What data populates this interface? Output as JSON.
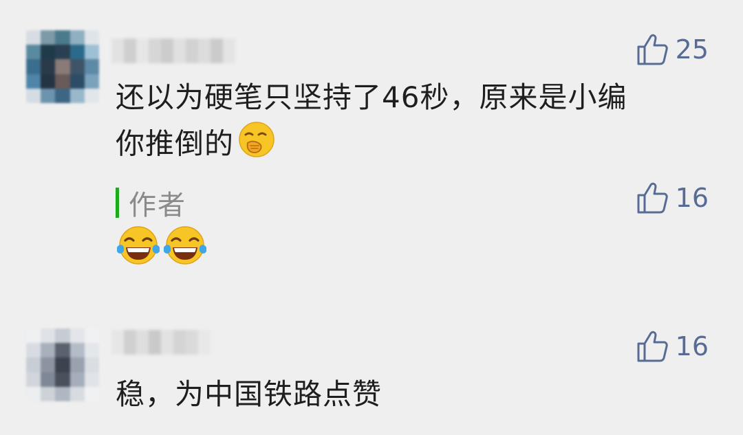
{
  "comments": [
    {
      "likes": "25",
      "text_line1": "还以为硬笔只坚持了46秒，原来是小编",
      "text_line2": "你推倒的",
      "emoji": "face-with-hand-over-mouth-icon",
      "reply": {
        "label": "作者",
        "likes": "16",
        "emojis": [
          "face-with-tears-of-joy-icon",
          "face-with-tears-of-joy-icon"
        ]
      }
    },
    {
      "likes": "16",
      "text": "稳，为中国铁路点赞"
    }
  ],
  "colors": {
    "background": "#efefef",
    "like": "#576b95",
    "author_bar": "#1aad19",
    "author_text": "#8a8a8a",
    "text": "#1e1e1e"
  }
}
